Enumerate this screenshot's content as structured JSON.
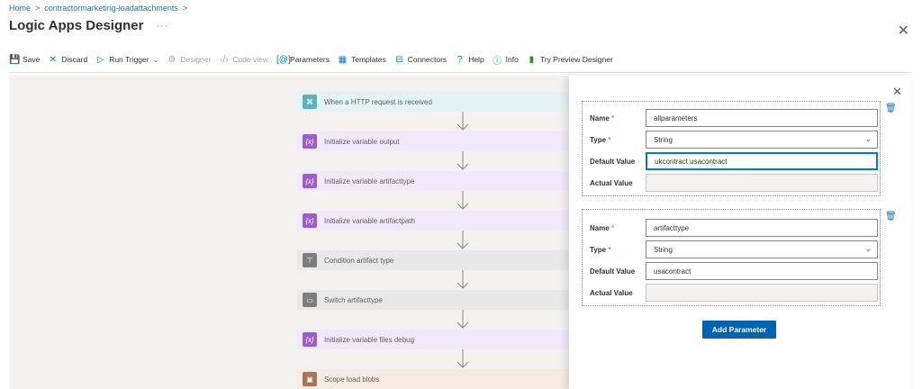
{
  "breadcrumb": {
    "home": "Home",
    "app": "contractormarketing-loadattachments",
    "sep": ">"
  },
  "header": {
    "title": "Logic Apps Designer",
    "more": "···"
  },
  "toolbar": {
    "save": "Save",
    "discard": "Discard",
    "run_trigger": "Run Trigger",
    "designer": "Designer",
    "code_view": "Code view",
    "parameters": "Parameters",
    "templates": "Templates",
    "connectors": "Connectors",
    "help": "Help",
    "info": "Info",
    "preview": "Try Preview Designer"
  },
  "steps": [
    {
      "label": "When a HTTP request is received",
      "kind": "http"
    },
    {
      "label": "Initialize variable output",
      "kind": "var"
    },
    {
      "label": "Initialize variable artifacttype",
      "kind": "var"
    },
    {
      "label": "Initialize variable artifactpath",
      "kind": "var"
    },
    {
      "label": "Condition artifact type",
      "kind": "cond"
    },
    {
      "label": "Switch artifacttype",
      "kind": "cond"
    },
    {
      "label": "Initialize variable files debug",
      "kind": "var"
    },
    {
      "label": "Scope load blobs",
      "kind": "scope"
    }
  ],
  "panel": {
    "labels": {
      "name": "Name",
      "type": "Type",
      "default": "Default Value",
      "actual": "Actual Value",
      "required": "*"
    },
    "params": [
      {
        "name": "allparameters",
        "type": "String",
        "default": "ukcontract usacontract",
        "actual": ""
      },
      {
        "name": "artifacttype",
        "type": "String",
        "default": "usacontract",
        "actual": ""
      }
    ],
    "add_button": "Add Parameter"
  },
  "icons": {
    "close": "close-icon",
    "trash": "trash-icon",
    "chevron": "chevron-down-icon"
  }
}
